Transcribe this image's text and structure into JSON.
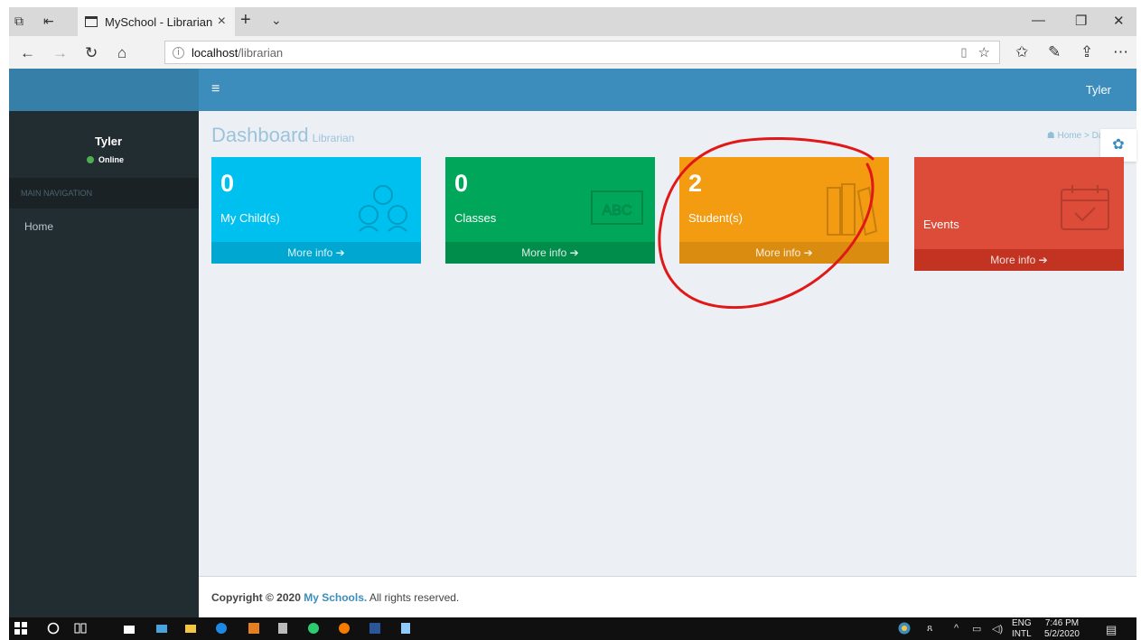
{
  "browser": {
    "tab_title": "MySchool - Librarian",
    "url_host": "localhost",
    "url_path": "/librarian"
  },
  "app": {
    "header_user": "Tyler",
    "sidebar": {
      "user_name": "Tyler",
      "status": "Online",
      "section": "MAIN NAVIGATION",
      "items": [
        "Home"
      ]
    },
    "page": {
      "title": "Dashboard",
      "subtitle": "Librarian",
      "breadcrumb": [
        "Home",
        "Dash"
      ]
    },
    "boxes": [
      {
        "value": "0",
        "label": "My Child(s)",
        "footer": "More info",
        "color": "#00c0ef",
        "footer_color": "#00a7d0",
        "icon": "family-icon"
      },
      {
        "value": "0",
        "label": "Classes",
        "footer": "More info",
        "color": "#00a65a",
        "footer_color": "#008d4c",
        "icon": "chalkboard-icon"
      },
      {
        "value": "2",
        "label": "Student(s)",
        "footer": "More info",
        "color": "#f39c12",
        "footer_color": "#da8c10",
        "icon": "books-icon"
      },
      {
        "value": "",
        "label": "Events",
        "footer": "More info",
        "color": "#dd4b39",
        "footer_color": "#c23321",
        "icon": "calendar-icon"
      }
    ],
    "footer": {
      "prefix": "Copyright © 2020 ",
      "brand": "My Schools.",
      "suffix": " All rights reserved."
    }
  },
  "taskbar": {
    "lang": "ENG",
    "lang2": "INTL",
    "time": "7:46 PM",
    "date": "5/2/2020"
  }
}
